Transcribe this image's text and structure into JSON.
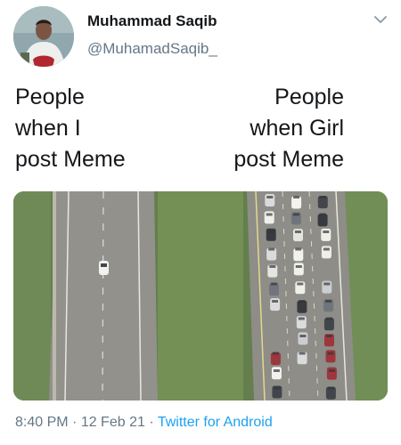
{
  "user": {
    "display_name": "Muhammad Saqib",
    "handle": "@MuhamadSaqib_"
  },
  "meme": {
    "left_lines": [
      "People",
      "when I",
      "post Meme"
    ],
    "right_lines": [
      "People",
      "when Girl",
      "post Meme"
    ]
  },
  "footer": {
    "time": "8:40 PM",
    "sep1": " · ",
    "date": "12 Feb 21",
    "sep2": " · ",
    "app": "Twitter for Android"
  },
  "icons": {
    "menu": "chevron-down-icon",
    "avatar": "avatar"
  },
  "colors": {
    "accent": "#1da1f2",
    "secondary_text": "#657786",
    "primary_text": "#14171a"
  }
}
